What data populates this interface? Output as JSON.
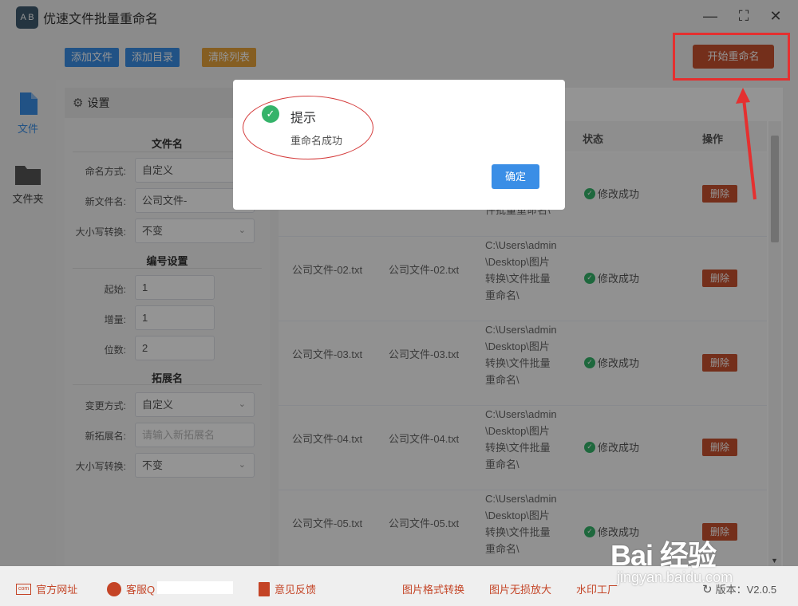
{
  "app": {
    "title": "优速文件批量重命名",
    "logo_text": "A B"
  },
  "window_controls": {
    "minimize": "—",
    "maximize": "⛶",
    "close": "✕"
  },
  "toolbar": {
    "add_file": "添加文件",
    "add_dir": "添加目录",
    "clear_list": "清除列表",
    "start_rename": "开始重命名"
  },
  "nav": {
    "file": "文件",
    "folder": "文件夹"
  },
  "settings": {
    "header": "设置",
    "filename_section": "文件名",
    "naming_mode_label": "命名方式:",
    "naming_mode_value": "自定义",
    "new_name_label": "新文件名:",
    "new_name_value": "公司文件-",
    "case_label": "大小写转换:",
    "case_value": "不变",
    "numbering_section": "编号设置",
    "start_label": "起始:",
    "start_value": "1",
    "increment_label": "增量:",
    "increment_value": "1",
    "digits_label": "位数:",
    "digits_value": "2",
    "ext_section": "拓展名",
    "ext_mode_label": "变更方式:",
    "ext_mode_value": "自定义",
    "new_ext_label": "新拓展名:",
    "new_ext_placeholder": "请输入新拓展名",
    "ext_case_label": "大小写转换:",
    "ext_case_value": "不变"
  },
  "table": {
    "headers": {
      "status": "状态",
      "action": "操作"
    },
    "rows": [
      {
        "path": "件批量重命名\\",
        "status": "修改成功",
        "action": "删除"
      },
      {
        "old": "公司文件-02.txt",
        "new": "公司文件-02.txt",
        "path": "C:\\Users\\admin\\Desktop\\图片转换\\文件批量重命名\\",
        "status": "修改成功",
        "action": "删除"
      },
      {
        "old": "公司文件-03.txt",
        "new": "公司文件-03.txt",
        "path": "C:\\Users\\admin\\Desktop\\图片转换\\文件批量重命名\\",
        "status": "修改成功",
        "action": "删除"
      },
      {
        "old": "公司文件-04.txt",
        "new": "公司文件-04.txt",
        "path": "C:\\Users\\admin\\Desktop\\图片转换\\文件批量重命名\\",
        "status": "修改成功",
        "action": "删除"
      },
      {
        "old": "公司文件-05.txt",
        "new": "公司文件-05.txt",
        "path": "C:\\Users\\admin\\Desktop\\图片转换\\文件批量重命名\\",
        "status": "修改成功",
        "action": "删除"
      }
    ]
  },
  "dialog": {
    "title": "提示",
    "message": "重命名成功",
    "confirm": "确定"
  },
  "footer": {
    "website": "官方网址",
    "support": "客服Q",
    "feedback": "意见反馈",
    "img_convert": "图片格式转换",
    "img_enlarge": "图片无损放大",
    "watermark": "水印工厂",
    "version": "版本：V2.0.5"
  },
  "watermark": {
    "brand": "Bai 经验",
    "url": "jingyan.baidu.com"
  },
  "colors": {
    "primary_blue": "#3a8ee6",
    "orange": "#e6a23c",
    "brand_red": "#c9522f",
    "success_green": "#35b36a",
    "annotation_red": "#e53030"
  }
}
